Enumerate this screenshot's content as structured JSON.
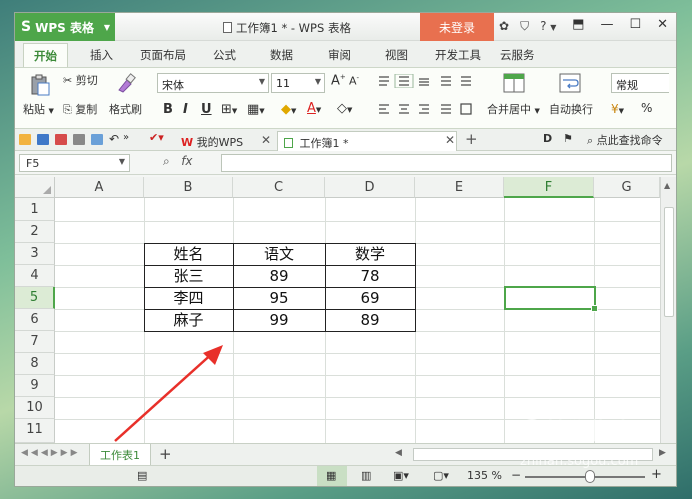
{
  "window": {
    "app_name": "WPS 表格",
    "title": "工作簿1 * - WPS 表格",
    "login_label": "未登录",
    "help_label": "?"
  },
  "menu_tabs": [
    "开始",
    "插入",
    "页面布局",
    "公式",
    "数据",
    "审阅",
    "视图",
    "开发工具",
    "云服务"
  ],
  "ribbon": {
    "paste": "粘贴",
    "cut": "剪切",
    "copy": "复制",
    "format_painter": "格式刷",
    "font_name": "宋体",
    "font_size": "11",
    "bold": "B",
    "italic": "I",
    "underline": "U",
    "merge_center": "合并居中",
    "wrap_text": "自动换行",
    "number_format": "常规",
    "percent": "%"
  },
  "quickbar": {
    "tab_mywps": "我的WPS",
    "tab_book": "工作簿1 *",
    "search_cmd": "点此查找命令"
  },
  "formula": {
    "name_box": "F5",
    "fx": "fx"
  },
  "sheet": {
    "columns": [
      "A",
      "B",
      "C",
      "D",
      "E",
      "F",
      "G"
    ],
    "rows": [
      "1",
      "2",
      "3",
      "4",
      "5",
      "6",
      "7",
      "8",
      "9",
      "10",
      "11"
    ],
    "selected_col": "F",
    "selected_row": "5",
    "table": [
      [
        "姓名",
        "语文",
        "数学"
      ],
      [
        "张三",
        "89",
        "78"
      ],
      [
        "李四",
        "95",
        "69"
      ],
      [
        "麻子",
        "99",
        "89"
      ]
    ]
  },
  "sheetbar": {
    "sheet_name": "工作表1",
    "add": "+"
  },
  "status": {
    "zoom": "135 %"
  },
  "watermark": {
    "brand": "搜狗指南",
    "url": "zhinan.sogou.com"
  },
  "colors": {
    "accent_green": "#4ea64a",
    "login_orange": "#e8704f",
    "arrow_red": "#e8302a"
  }
}
